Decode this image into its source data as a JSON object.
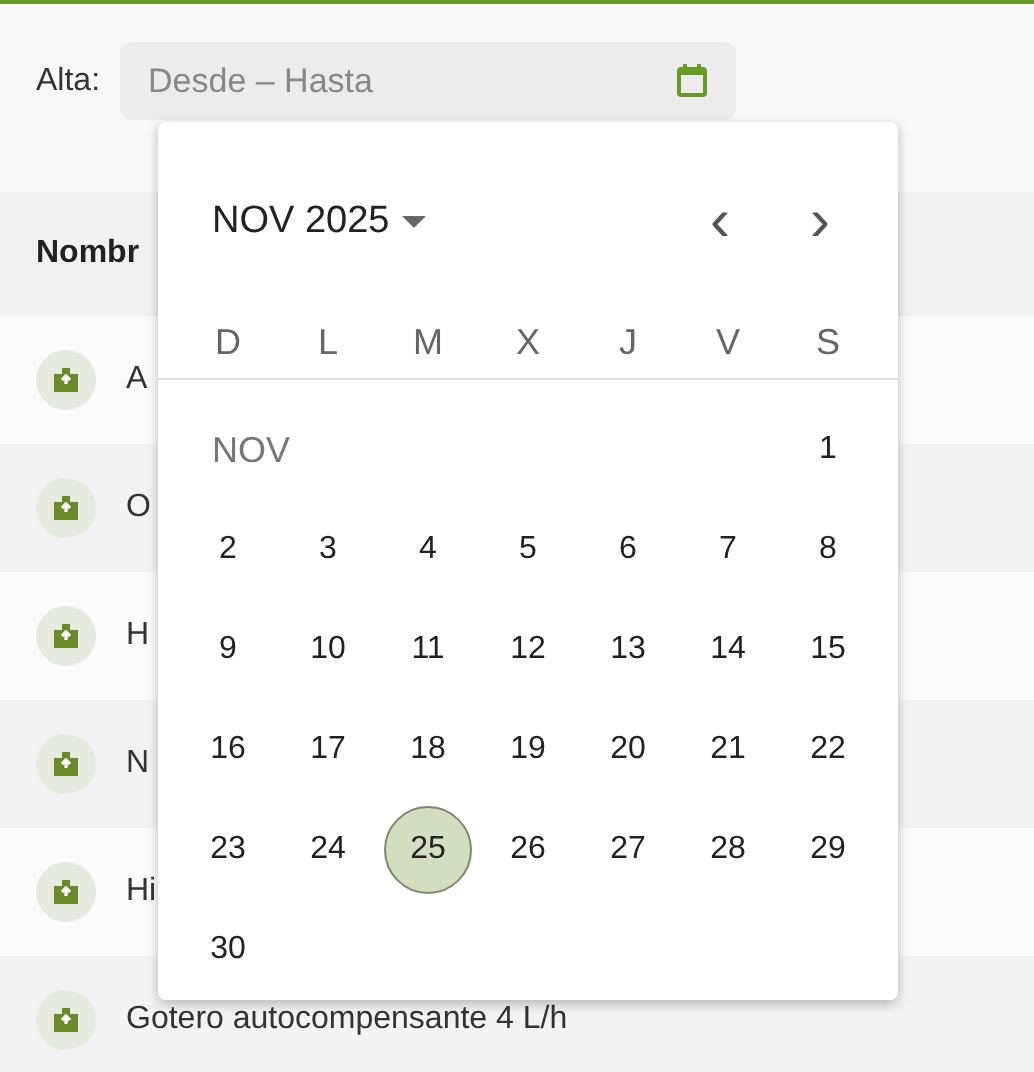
{
  "filter": {
    "label": "Alta:",
    "placeholder": "Desde – Hasta"
  },
  "table": {
    "columns": [
      {
        "label": "Nombr"
      }
    ],
    "rows": [
      {
        "name": "A"
      },
      {
        "name": "O"
      },
      {
        "name": "H"
      },
      {
        "name": "N"
      },
      {
        "name": "Hi"
      },
      {
        "name": "Gotero autocompensante 4 L/h"
      }
    ]
  },
  "calendar": {
    "title": "NOV 2025",
    "prev": "‹",
    "next": "›",
    "weekdays": [
      "D",
      "L",
      "M",
      "X",
      "J",
      "V",
      "S"
    ],
    "weeks": [
      {
        "month_label": "NOV",
        "days": [
          {
            "day": "1",
            "selected": false
          }
        ]
      },
      {
        "days": [
          {
            "day": "2",
            "selected": false
          },
          {
            "day": "3",
            "selected": false
          },
          {
            "day": "4",
            "selected": false
          },
          {
            "day": "5",
            "selected": false
          },
          {
            "day": "6",
            "selected": false
          },
          {
            "day": "7",
            "selected": false
          },
          {
            "day": "8",
            "selected": false
          }
        ]
      },
      {
        "days": [
          {
            "day": "9",
            "selected": false
          },
          {
            "day": "10",
            "selected": false
          },
          {
            "day": "11",
            "selected": false
          },
          {
            "day": "12",
            "selected": false
          },
          {
            "day": "13",
            "selected": false
          },
          {
            "day": "14",
            "selected": false
          },
          {
            "day": "15",
            "selected": false
          }
        ]
      },
      {
        "days": [
          {
            "day": "16",
            "selected": false
          },
          {
            "day": "17",
            "selected": false
          },
          {
            "day": "18",
            "selected": false
          },
          {
            "day": "19",
            "selected": false
          },
          {
            "day": "20",
            "selected": false
          },
          {
            "day": "21",
            "selected": false
          },
          {
            "day": "22",
            "selected": false
          }
        ]
      },
      {
        "days": [
          {
            "day": "23",
            "selected": false
          },
          {
            "day": "24",
            "selected": false
          },
          {
            "day": "25",
            "selected": true
          },
          {
            "day": "26",
            "selected": false
          },
          {
            "day": "27",
            "selected": false
          },
          {
            "day": "28",
            "selected": false
          },
          {
            "day": "29",
            "selected": false
          }
        ]
      },
      {
        "days": [
          {
            "day": "30",
            "selected": false
          }
        ]
      }
    ]
  }
}
